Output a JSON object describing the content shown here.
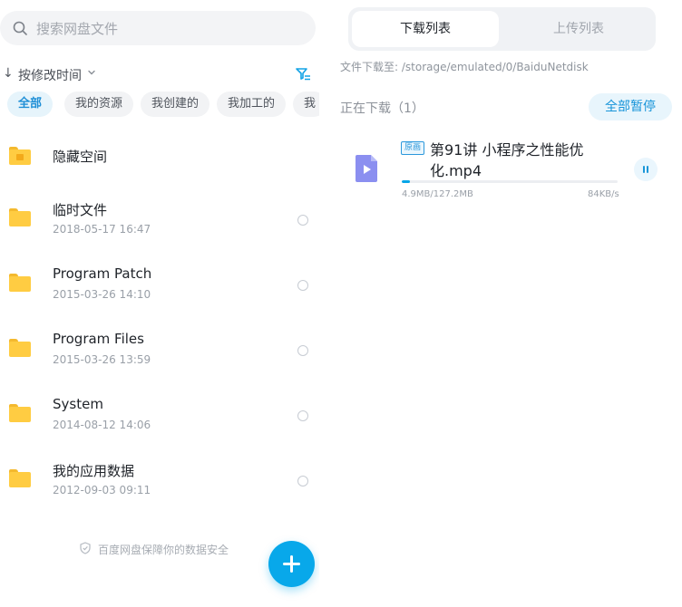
{
  "left": {
    "search": {
      "placeholder": "搜索网盘文件",
      "icon": "search-icon"
    },
    "sort": {
      "arrow": "↓",
      "label": "按修改时间",
      "caret_icon": "chevron-down-icon",
      "filter_icon": "filter-icon"
    },
    "chips": [
      "全部",
      "我的资源",
      "我创建的",
      "我加工的",
      "我"
    ],
    "files": [
      {
        "name": "隐藏空间",
        "date": "",
        "locked": true
      },
      {
        "name": "临时文件",
        "date": "2018-05-17  16:47"
      },
      {
        "name": "Program Patch",
        "date": "2015-03-26  14:10"
      },
      {
        "name": "Program Files",
        "date": "2015-03-26  13:59"
      },
      {
        "name": "System",
        "date": "2014-08-12  14:06"
      },
      {
        "name": "我的应用数据",
        "date": "2012-09-03  09:11"
      }
    ],
    "safety_text": "百度网盘保障你的数据安全",
    "fab_icon": "plus-icon"
  },
  "right": {
    "tabs": {
      "active": "下载列表",
      "inactive": "上传列表"
    },
    "path": "文件下载至: /storage/emulated/0/BaiduNetdisk",
    "downloading_label": "正在下载（1）",
    "pause_all": "全部暂停",
    "item": {
      "badge": "原画",
      "title_line1": "第91讲  小程序之性能优",
      "title_line2": "化.mp4",
      "progress": 0.038,
      "size": "4.9MB/127.2MB",
      "speed": "84KB/s",
      "file_icon": "video-file-icon",
      "pause_icon": "pause-icon"
    }
  },
  "colors": {
    "accent": "#08a8ea",
    "folder": "#ffcc42"
  }
}
